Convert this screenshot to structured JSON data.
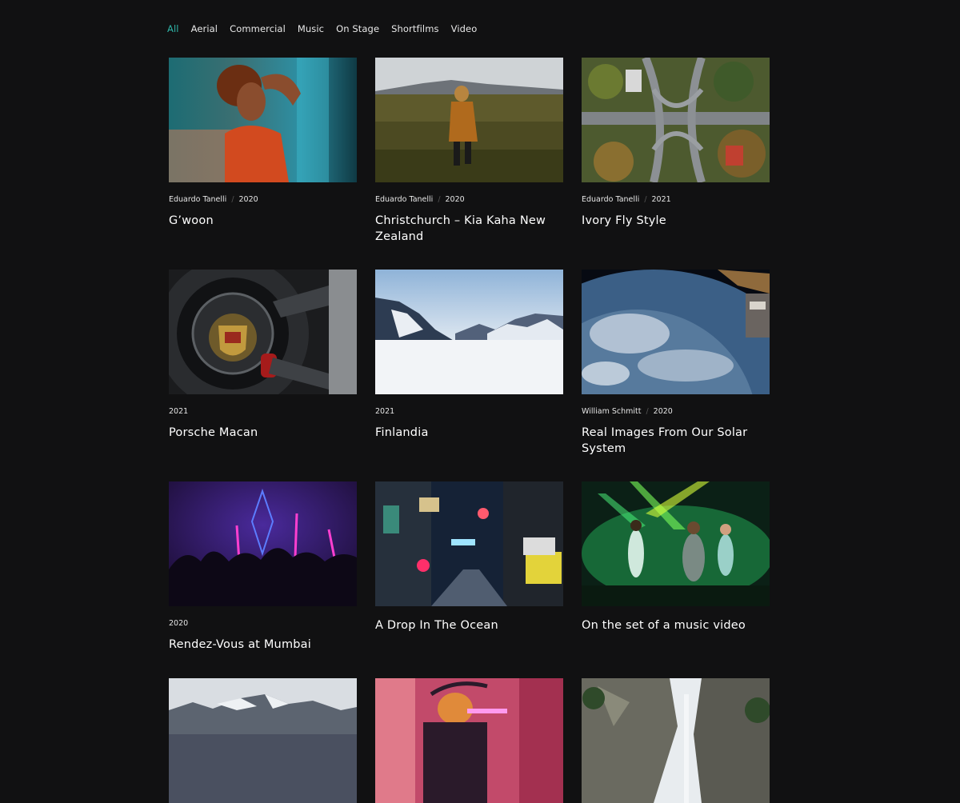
{
  "filters": [
    {
      "label": "All",
      "active": true
    },
    {
      "label": "Aerial",
      "active": false
    },
    {
      "label": "Commercial",
      "active": false
    },
    {
      "label": "Music",
      "active": false
    },
    {
      "label": "On Stage",
      "active": false
    },
    {
      "label": "Shortfilms",
      "active": false
    },
    {
      "label": "Video",
      "active": false
    }
  ],
  "colors": {
    "accent": "#2fb5a8",
    "background": "#111112",
    "text": "#ffffff"
  },
  "cards": [
    {
      "author": "Eduardo Tanelli",
      "year": "2020",
      "title": "G’woon",
      "image": "portrait-woman-image"
    },
    {
      "author": "Eduardo Tanelli",
      "year": "2020",
      "title": "Christchurch – Kia Kaha New Zealand",
      "image": "hiker-grassland-image"
    },
    {
      "author": "Eduardo Tanelli",
      "year": "2021",
      "title": "Ivory Fly Style",
      "image": "highway-interchange-image"
    },
    {
      "author": "",
      "year": "2021",
      "title": "Porsche Macan",
      "image": "porsche-wheel-image"
    },
    {
      "author": "",
      "year": "2021",
      "title": "Finlandia",
      "image": "snowy-mountains-image"
    },
    {
      "author": "William Schmitt",
      "year": "2020",
      "title": "Real Images From Our Solar System",
      "image": "earth-from-space-image"
    },
    {
      "author": "",
      "year": "2020",
      "title": "Rendez-Vous at Mumbai",
      "image": "neon-crowd-image"
    },
    {
      "author": "",
      "year": "",
      "title": "A Drop In The Ocean",
      "image": "night-alley-image"
    },
    {
      "author": "",
      "year": "",
      "title": "On the set of a music video",
      "image": "green-stage-image"
    },
    {
      "author": "",
      "year": "",
      "title": "",
      "image": "mountain-range-image"
    },
    {
      "author": "",
      "year": "",
      "title": "",
      "image": "pink-studio-image"
    },
    {
      "author": "",
      "year": "",
      "title": "",
      "image": "waterfall-cliffs-image"
    }
  ]
}
